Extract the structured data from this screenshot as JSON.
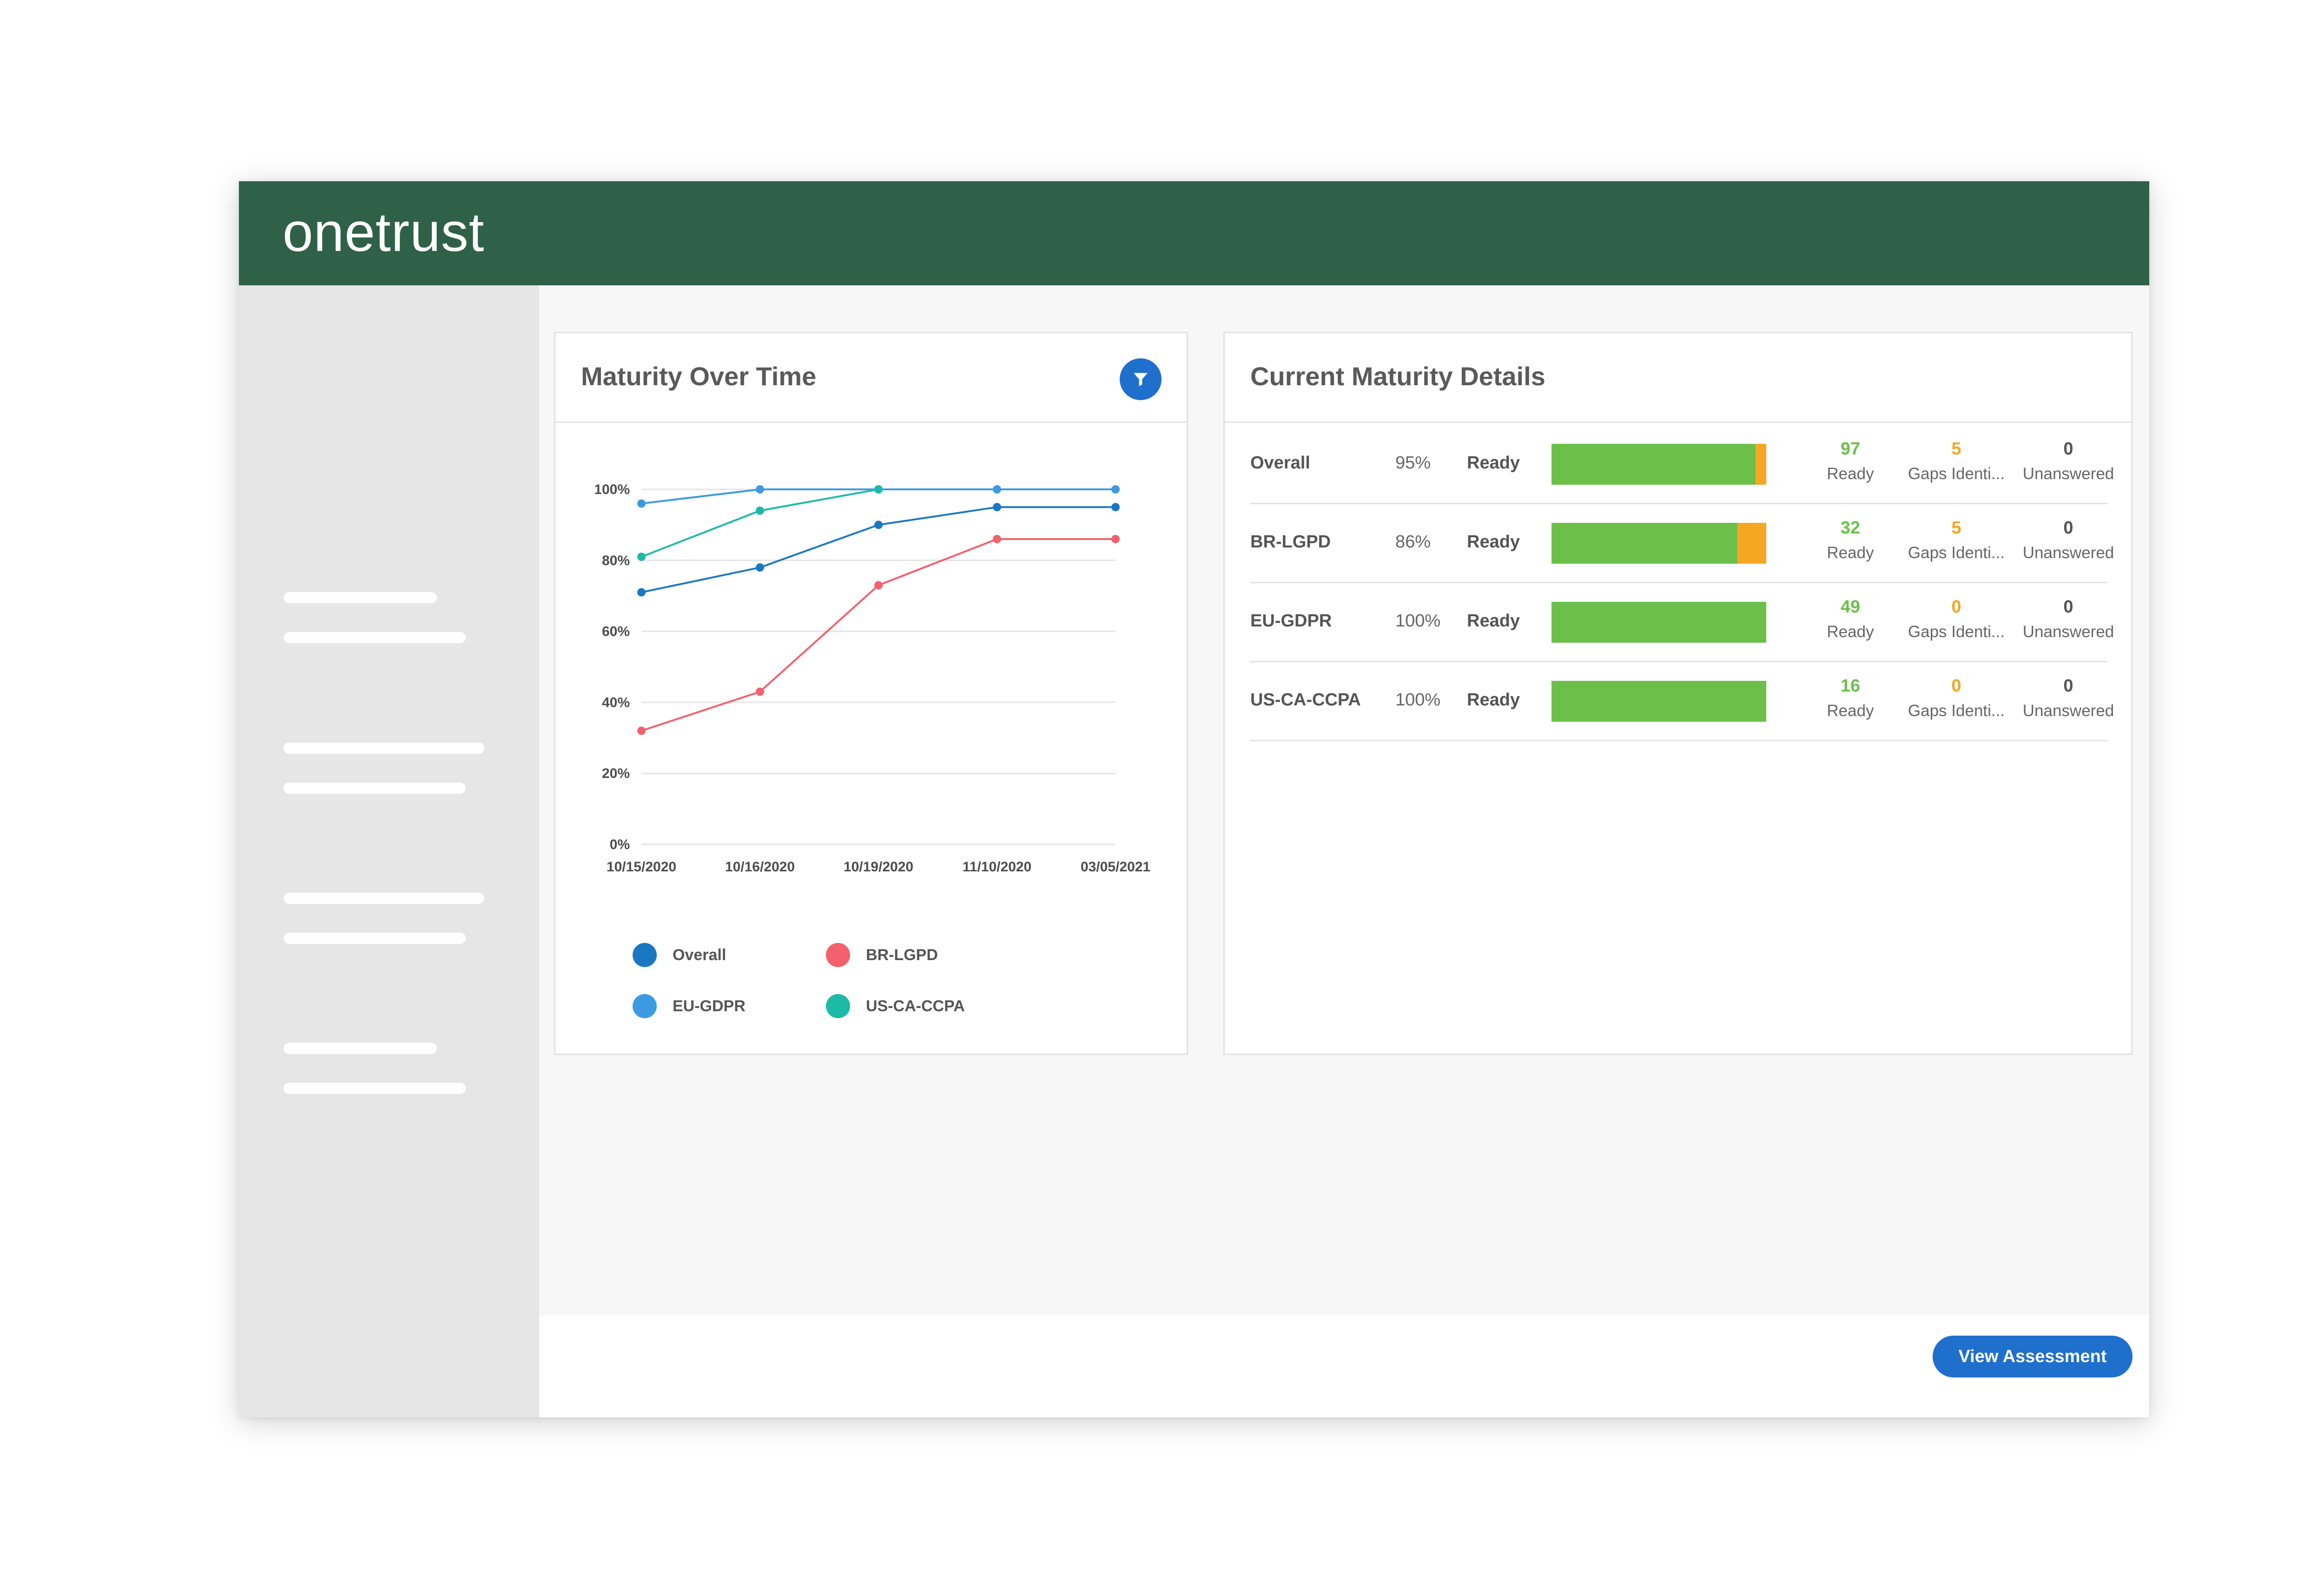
{
  "app": {
    "brand": "onetrust"
  },
  "maturity_card": {
    "title": "Maturity Over Time",
    "filter_icon": "filter-icon"
  },
  "chart_data": {
    "type": "line",
    "categories": [
      "10/15/2020",
      "10/16/2020",
      "10/19/2020",
      "11/10/2020",
      "03/05/2021"
    ],
    "y_ticks": [
      "100%",
      "80%",
      "60%",
      "40%",
      "20%",
      "0%"
    ],
    "ylim": [
      0,
      100
    ],
    "grid": true,
    "legend_position": "bottom",
    "series": [
      {
        "name": "Overall",
        "color": "#1a78c2",
        "values": [
          71,
          78,
          90,
          95,
          95
        ]
      },
      {
        "name": "BR-LGPD",
        "color": "#f4606c",
        "values": [
          32,
          43,
          73,
          86,
          86
        ]
      },
      {
        "name": "EU-GDPR",
        "color": "#3c9be0",
        "values": [
          96,
          100,
          100,
          100,
          100
        ]
      },
      {
        "name": "US-CA-CCPA",
        "color": "#1ebaa8",
        "values": [
          81,
          94,
          100,
          null,
          null
        ]
      }
    ]
  },
  "details_card": {
    "title": "Current Maturity Details",
    "rows": [
      {
        "name": "Overall",
        "percent": "95%",
        "status": "Ready",
        "ready_fraction": 0.95,
        "ready": "97",
        "ready_label": "Ready",
        "gaps": "5",
        "gaps_label": "Gaps Identi...",
        "unanswered": "0",
        "unanswered_label": "Unanswered"
      },
      {
        "name": "BR-LGPD",
        "percent": "86%",
        "status": "Ready",
        "ready_fraction": 0.865,
        "ready": "32",
        "ready_label": "Ready",
        "gaps": "5",
        "gaps_label": "Gaps Identi...",
        "unanswered": "0",
        "unanswered_label": "Unanswered"
      },
      {
        "name": "EU-GDPR",
        "percent": "100%",
        "status": "Ready",
        "ready_fraction": 1.0,
        "ready": "49",
        "ready_label": "Ready",
        "gaps": "0",
        "gaps_label": "Gaps Identi...",
        "unanswered": "0",
        "unanswered_label": "Unanswered"
      },
      {
        "name": "US-CA-CCPA",
        "percent": "100%",
        "status": "Ready",
        "ready_fraction": 1.0,
        "ready": "16",
        "ready_label": "Ready",
        "gaps": "0",
        "gaps_label": "Gaps Identi...",
        "unanswered": "0",
        "unanswered_label": "Unanswered"
      }
    ]
  },
  "colors": {
    "ready": "#6cc04a",
    "gaps": "#f5a623",
    "unanswered": "#555555",
    "header": "#2e6147",
    "primary": "#1f6fcd"
  },
  "footer": {
    "view_assessment_label": "View Assessment"
  }
}
